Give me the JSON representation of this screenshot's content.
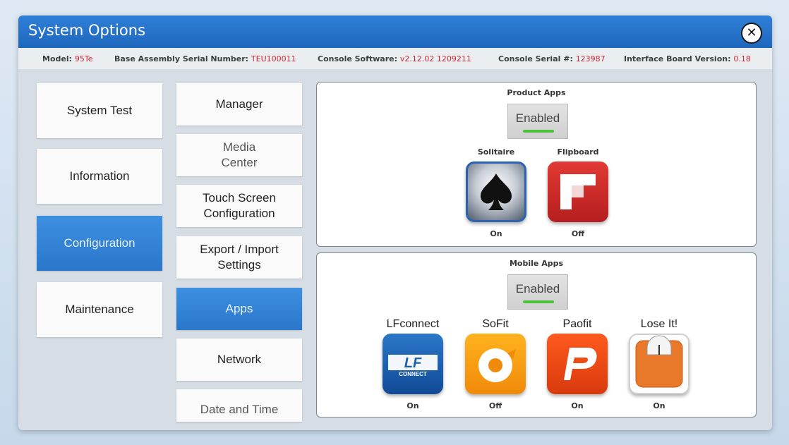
{
  "window": {
    "title": "System Options",
    "close_glyph": "✕"
  },
  "info": {
    "model_label": "Model:",
    "model_value": "95Te",
    "serial_label": "Base Assembly Serial Number:",
    "serial_value": "TEU100011",
    "console_sw_label": "Console Software:",
    "console_sw_value": "v2.12.02 1209211",
    "console_serial_label": "Console Serial #:",
    "console_serial_value": "123987",
    "interface_label": "Interface Board Version:",
    "interface_value": "0.18"
  },
  "nav": {
    "items": [
      {
        "label": "System Test",
        "active": false
      },
      {
        "label": "Information",
        "active": false
      },
      {
        "label": "Configuration",
        "active": true
      },
      {
        "label": "Maintenance",
        "active": false
      }
    ]
  },
  "subnav": {
    "items": [
      {
        "label": "Manager",
        "active": false
      },
      {
        "label": "Media\nCenter",
        "active": false
      },
      {
        "label": "Touch Screen\nConfiguration",
        "active": false
      },
      {
        "label": "Export / Import\nSettings",
        "active": false
      },
      {
        "label": "Apps",
        "active": true
      },
      {
        "label": "Network",
        "active": false
      },
      {
        "label": "Date and Time",
        "active": false
      }
    ]
  },
  "product_apps": {
    "heading": "Product Apps",
    "toggle_label": "Enabled",
    "apps": [
      {
        "name": "Solitaire",
        "state": "On",
        "icon": "spade-icon"
      },
      {
        "name": "Flipboard",
        "state": "Off",
        "icon": "flipboard-icon"
      }
    ]
  },
  "mobile_apps": {
    "heading": "Mobile Apps",
    "toggle_label": "Enabled",
    "apps": [
      {
        "name": "LFconnect",
        "state": "On",
        "icon": "lfconnect-icon",
        "icon_text_1": "LF",
        "icon_text_2": "CONNECT"
      },
      {
        "name": "SoFit",
        "state": "Off",
        "icon": "sofit-icon"
      },
      {
        "name": "Paofit",
        "state": "On",
        "icon": "paofit-icon"
      },
      {
        "name": "Lose It!",
        "state": "On",
        "icon": "scale-icon"
      }
    ]
  },
  "colors": {
    "title_bar": "#1e67bd",
    "active_nav": "#2a77cc",
    "value_red": "#d0252e",
    "led_green": "#4cc23a"
  }
}
